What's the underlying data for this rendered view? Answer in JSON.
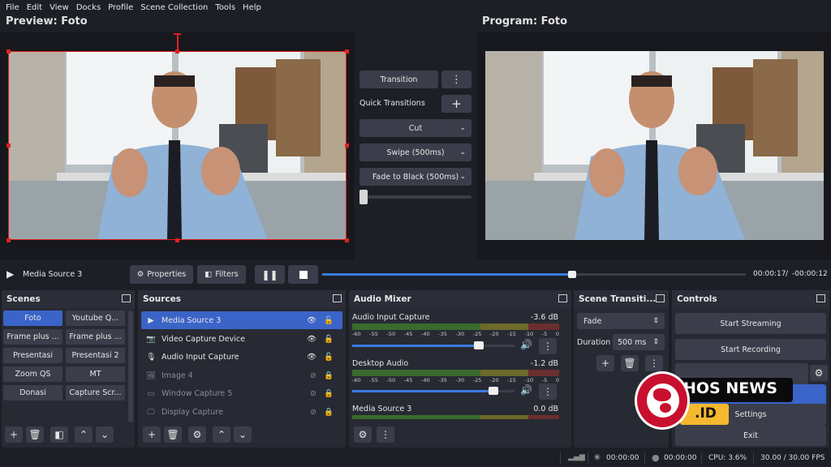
{
  "menu": [
    "File",
    "Edit",
    "View",
    "Docks",
    "Profile",
    "Scene Collection",
    "Tools",
    "Help"
  ],
  "preview_title": "Preview: Foto",
  "program_title": "Program: Foto",
  "transition": {
    "button": "Transition",
    "quick_label": "Quick Transitions",
    "items": [
      "Cut",
      "Swipe (500ms)",
      "Fade to Black (500ms)"
    ]
  },
  "media": {
    "source": "Media Source 3",
    "properties": "Properties",
    "filters": "Filters",
    "time_elapsed": "00:00:17",
    "time_sep": "/",
    "time_remaining": "-00:00:12",
    "progress": 0.59
  },
  "scenes": {
    "title": "Scenes",
    "items": [
      "Foto",
      "Youtube Q...",
      "Frame plus ...",
      "Frame plus ...",
      "Presentasi",
      "Presentasi 2",
      "Zoom QS",
      "MT",
      "Donasi",
      "Capture Scr..."
    ]
  },
  "sources": {
    "title": "Sources",
    "items": [
      {
        "name": "Media Source 3",
        "icon": "play-icon"
      },
      {
        "name": "Video Capture Device",
        "icon": "camera-icon"
      },
      {
        "name": "Audio Input Capture",
        "icon": "microphone-icon"
      },
      {
        "name": "Image 4",
        "icon": "image-icon"
      },
      {
        "name": "Window Capture 5",
        "icon": "window-icon"
      },
      {
        "name": "Display Capture",
        "icon": "display-icon"
      }
    ]
  },
  "mixer": {
    "title": "Audio Mixer",
    "scale": [
      "-60",
      "-55",
      "-50",
      "-45",
      "-40",
      "-35",
      "-30",
      "-25",
      "-20",
      "-15",
      "-10",
      "-5",
      "0"
    ],
    "channels": [
      {
        "name": "Audio Input Capture",
        "db": "-3.6 dB",
        "volume": 0.78
      },
      {
        "name": "Desktop Audio",
        "db": "-1.2 dB",
        "volume": 0.87
      },
      {
        "name": "Media Source 3",
        "db": "0.0 dB"
      }
    ]
  },
  "scene_transitions": {
    "title": "Scene Transiti...",
    "type": "Fade",
    "duration_label": "Duration",
    "duration_value": "500 ms"
  },
  "controls": {
    "title": "Controls",
    "start_streaming": "Start Streaming",
    "start_recording": "Start Recording",
    "settings": "Settings",
    "exit": "Exit"
  },
  "watermark": {
    "text_main": "HOS NEWS",
    "text_sub": ".ID"
  },
  "status": {
    "stream_time": "00:00:00",
    "rec_time": "00:00:00",
    "cpu": "CPU: 3.6%",
    "fps": "30.00 / 30.00 FPS"
  },
  "colors": {
    "accent": "#3b64c8",
    "selection": "#e02020",
    "panel": "#272a33",
    "button": "#3b3e4a"
  }
}
